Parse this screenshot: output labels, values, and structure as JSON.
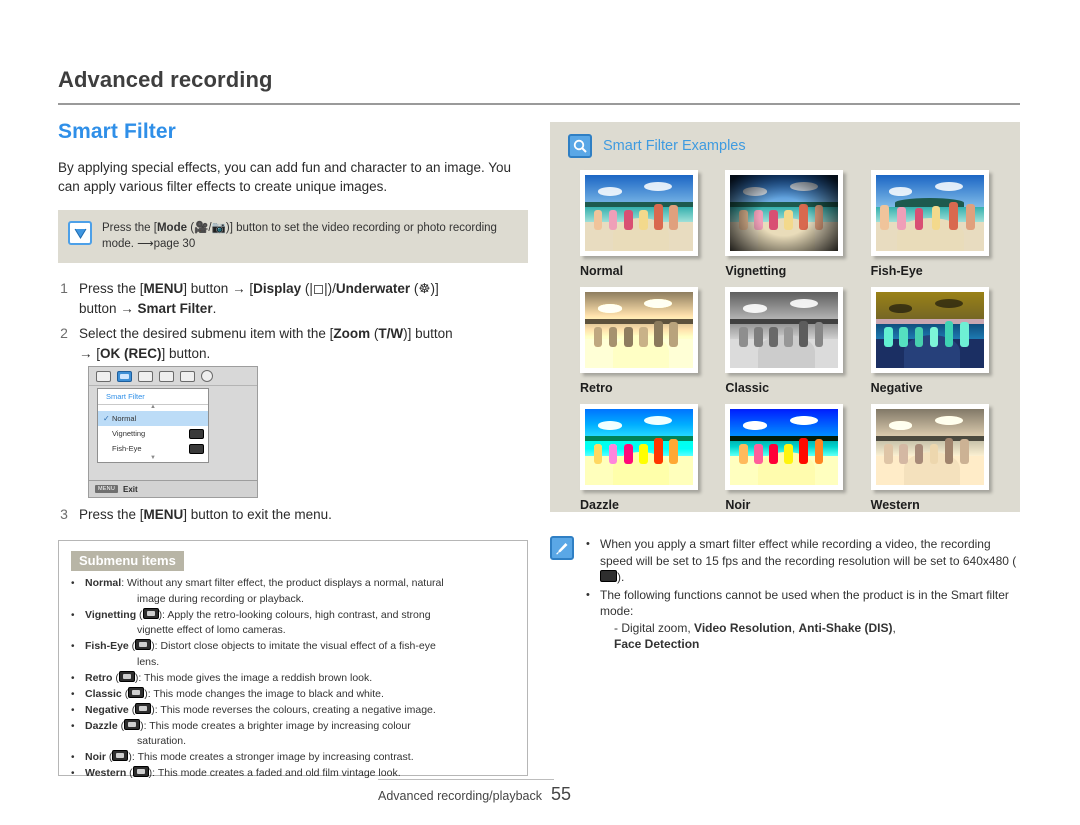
{
  "header": {
    "chapter_title": "Advanced recording"
  },
  "left": {
    "section_title": "Smart Filter",
    "intro": "By applying special effects, you can add fun and character to an image. You can apply various filter effects to create unique images.",
    "tip": {
      "icon": "check-square-icon",
      "text_before": "Press the [",
      "mode_label": "Mode",
      "mode_icons": "(🎥/📷)",
      "text_after": ")] button to set the video recording or photo recording mode. ➡page 30",
      "full_text": "Press the [Mode (🎥/📷)] button to set the video recording or photo recording mode. ➡page 30"
    },
    "steps": [
      {
        "num": "1",
        "text": "Press the [MENU] button → [Display (|□|)/Underwater (⌾)] button → Smart Filter."
      },
      {
        "num": "2",
        "text": "Select the desired submenu item with the [Zoom (T/W)] button → [OK (REC)] button."
      },
      {
        "num": "3",
        "text": "Press the [MENU] button to exit the menu."
      }
    ],
    "lcd": {
      "panel_title": "Smart Filter",
      "rows": [
        {
          "label": "Normal",
          "checked": true,
          "has_icon": false
        },
        {
          "label": "Vignetting",
          "checked": false,
          "has_icon": true
        },
        {
          "label": "Fish-Eye",
          "checked": false,
          "has_icon": true
        }
      ],
      "menu_key": "MENU",
      "exit_label": "Exit",
      "up_arrow": "▲",
      "down_arrow": "▼",
      "check_glyph": "✓"
    },
    "submenu": {
      "badge": "Submenu items",
      "items": [
        {
          "name": "Normal",
          "has_icon": false,
          "desc": ": Without any smart filter effect, the product displays a normal, natural",
          "cont": "image during recording or playback."
        },
        {
          "name": "Vignetting",
          "has_icon": true,
          "desc": "): Apply the retro-looking colours, high contrast, and strong",
          "cont": "vignette effect of lomo cameras."
        },
        {
          "name": "Fish-Eye",
          "has_icon": true,
          "desc": "): Distort close objects to imitate the visual effect of a fish-eye",
          "cont": "lens."
        },
        {
          "name": "Retro",
          "has_icon": true,
          "desc": "): This mode gives the image a reddish brown look.",
          "cont": ""
        },
        {
          "name": "Classic",
          "has_icon": true,
          "desc": "): This mode changes the image to black and white.",
          "cont": ""
        },
        {
          "name": "Negative",
          "has_icon": true,
          "desc": "): This mode reverses the colours, creating a negative image.",
          "cont": ""
        },
        {
          "name": "Dazzle",
          "has_icon": true,
          "desc": "): This mode creates a brighter image by increasing colour",
          "cont": "saturation."
        },
        {
          "name": "Noir",
          "has_icon": true,
          "desc": "): This mode creates a stronger image by increasing contrast.",
          "cont": ""
        },
        {
          "name": "Western",
          "has_icon": true,
          "desc": "): This mode creates a faded and old film vintage look.",
          "cont": ""
        }
      ]
    }
  },
  "right": {
    "examples": {
      "icon": "magnifier-icon",
      "title": "Smart Filter Examples",
      "items": [
        {
          "label": "Normal",
          "filter": "none"
        },
        {
          "label": "Vignetting",
          "filter": "vignette"
        },
        {
          "label": "Fish-Eye",
          "filter": "fisheye"
        },
        {
          "label": "Retro",
          "filter": "sepia"
        },
        {
          "label": "Classic",
          "filter": "bw"
        },
        {
          "label": "Negative",
          "filter": "invert"
        },
        {
          "label": "Dazzle",
          "filter": "saturate"
        },
        {
          "label": "Noir",
          "filter": "contrast"
        },
        {
          "label": "Western",
          "filter": "faded"
        }
      ]
    },
    "note": {
      "icon": "note-pen-icon",
      "bullets": [
        "When you apply a smart filter effect while recording a video, the recording speed will be set to 15 fps and the recording resolution will be set to 640x480 (▤).",
        "The following functions cannot be used when the product is in the Smart filter mode:"
      ],
      "sub_line_prefix": "- Digital zoom, ",
      "sub_line_b1": "Video Resolution",
      "sub_line_mid": ", ",
      "sub_line_b2": "Anti-Shake (DIS)",
      "sub_line_end": ",",
      "sub_line_b3": "Face Detection"
    }
  },
  "footer": {
    "label": "Advanced recording/playback",
    "page_number": "55"
  },
  "colors": {
    "accent_blue": "#2f8fe8",
    "panel_grey": "#dddbd1",
    "badge_grey": "#b8b5a6",
    "rule_grey": "#9a9a9a"
  }
}
